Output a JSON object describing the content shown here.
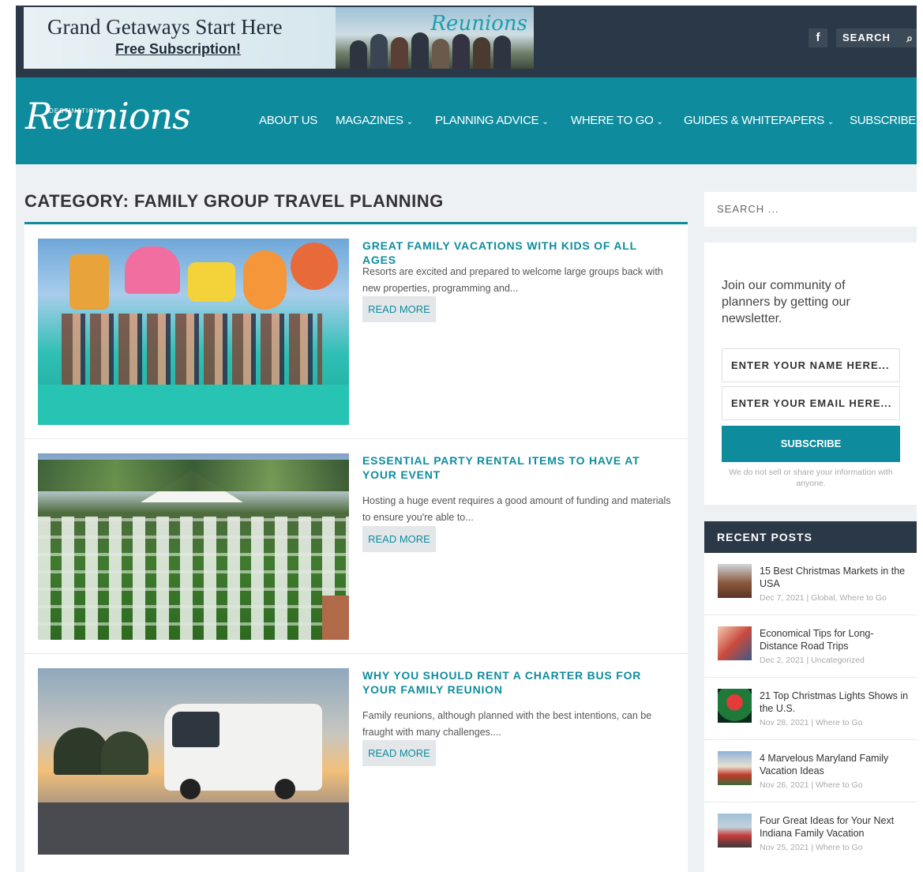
{
  "promo": {
    "title": "Grand Getaways Start Here",
    "link": "Free Subscription!",
    "logo": "Reunions"
  },
  "topbar": {
    "facebook_icon": "facebook-icon",
    "search_label": "SEARCH",
    "search_icon": "magnifier-icon"
  },
  "brand": {
    "logo_script": "Reunions",
    "logo_small": "DESTINATION"
  },
  "nav": {
    "items": [
      {
        "label": "ABOUT US",
        "dropdown": false
      },
      {
        "label": "MAGAZINES",
        "dropdown": true
      },
      {
        "label": "PLANNING ADVICE",
        "dropdown": true
      },
      {
        "label": "WHERE TO GO",
        "dropdown": true
      },
      {
        "label": "GUIDES & WHITEPAPERS",
        "dropdown": true
      },
      {
        "label": "SUBSCRIBE",
        "dropdown": false
      }
    ]
  },
  "page": {
    "category_title": "CATEGORY: FAMILY GROUP TRAVEL PLANNING"
  },
  "posts": [
    {
      "title": "GREAT FAMILY VACATIONS WITH KIDS OF ALL AGES",
      "excerpt": "Resorts are excited and prepared to welcome large groups back with new properties, programming and...",
      "read_more": "READ MORE"
    },
    {
      "title": "ESSENTIAL PARTY RENTAL ITEMS TO HAVE AT YOUR EVENT",
      "excerpt": "Hosting a huge event requires a good amount of funding and materials to ensure you're able to...",
      "read_more": "READ MORE"
    },
    {
      "title": "WHY YOU SHOULD RENT A CHARTER BUS FOR YOUR FAMILY REUNION",
      "excerpt": "Family reunions, although planned with the best intentions, can be fraught with many challenges....",
      "read_more": "READ MORE"
    }
  ],
  "sidebar": {
    "search_placeholder": "SEARCH ...",
    "newsletter": {
      "text": "Join our community of planners by getting our newsletter.",
      "name_placeholder": "ENTER YOUR NAME HERE...",
      "email_placeholder": "ENTER YOUR EMAIL HERE...",
      "button": "SUBSCRIBE",
      "note": "We do not sell or share your information with anyone."
    },
    "recent_title": "RECENT POSTS",
    "recent": [
      {
        "title": "15 Best Christmas Markets in the USA",
        "meta": "Dec 7, 2021 | Global, Where to Go"
      },
      {
        "title": "Economical Tips for Long-Distance Road Trips",
        "meta": "Dec 2, 2021 | Uncategorized"
      },
      {
        "title": "21 Top Christmas Lights Shows in the U.S.",
        "meta": "Nov 28, 2021 | Where to Go"
      },
      {
        "title": "4 Marvelous Maryland Family Vacation Ideas",
        "meta": "Nov 26, 2021 | Where to Go"
      },
      {
        "title": "Four Great Ideas for Your Next Indiana Family Vacation",
        "meta": "Nov 25, 2021 | Where to Go"
      }
    ]
  },
  "colors": {
    "teal": "#0e8c9e",
    "dark": "#2b3847",
    "background": "#eef1f4"
  }
}
